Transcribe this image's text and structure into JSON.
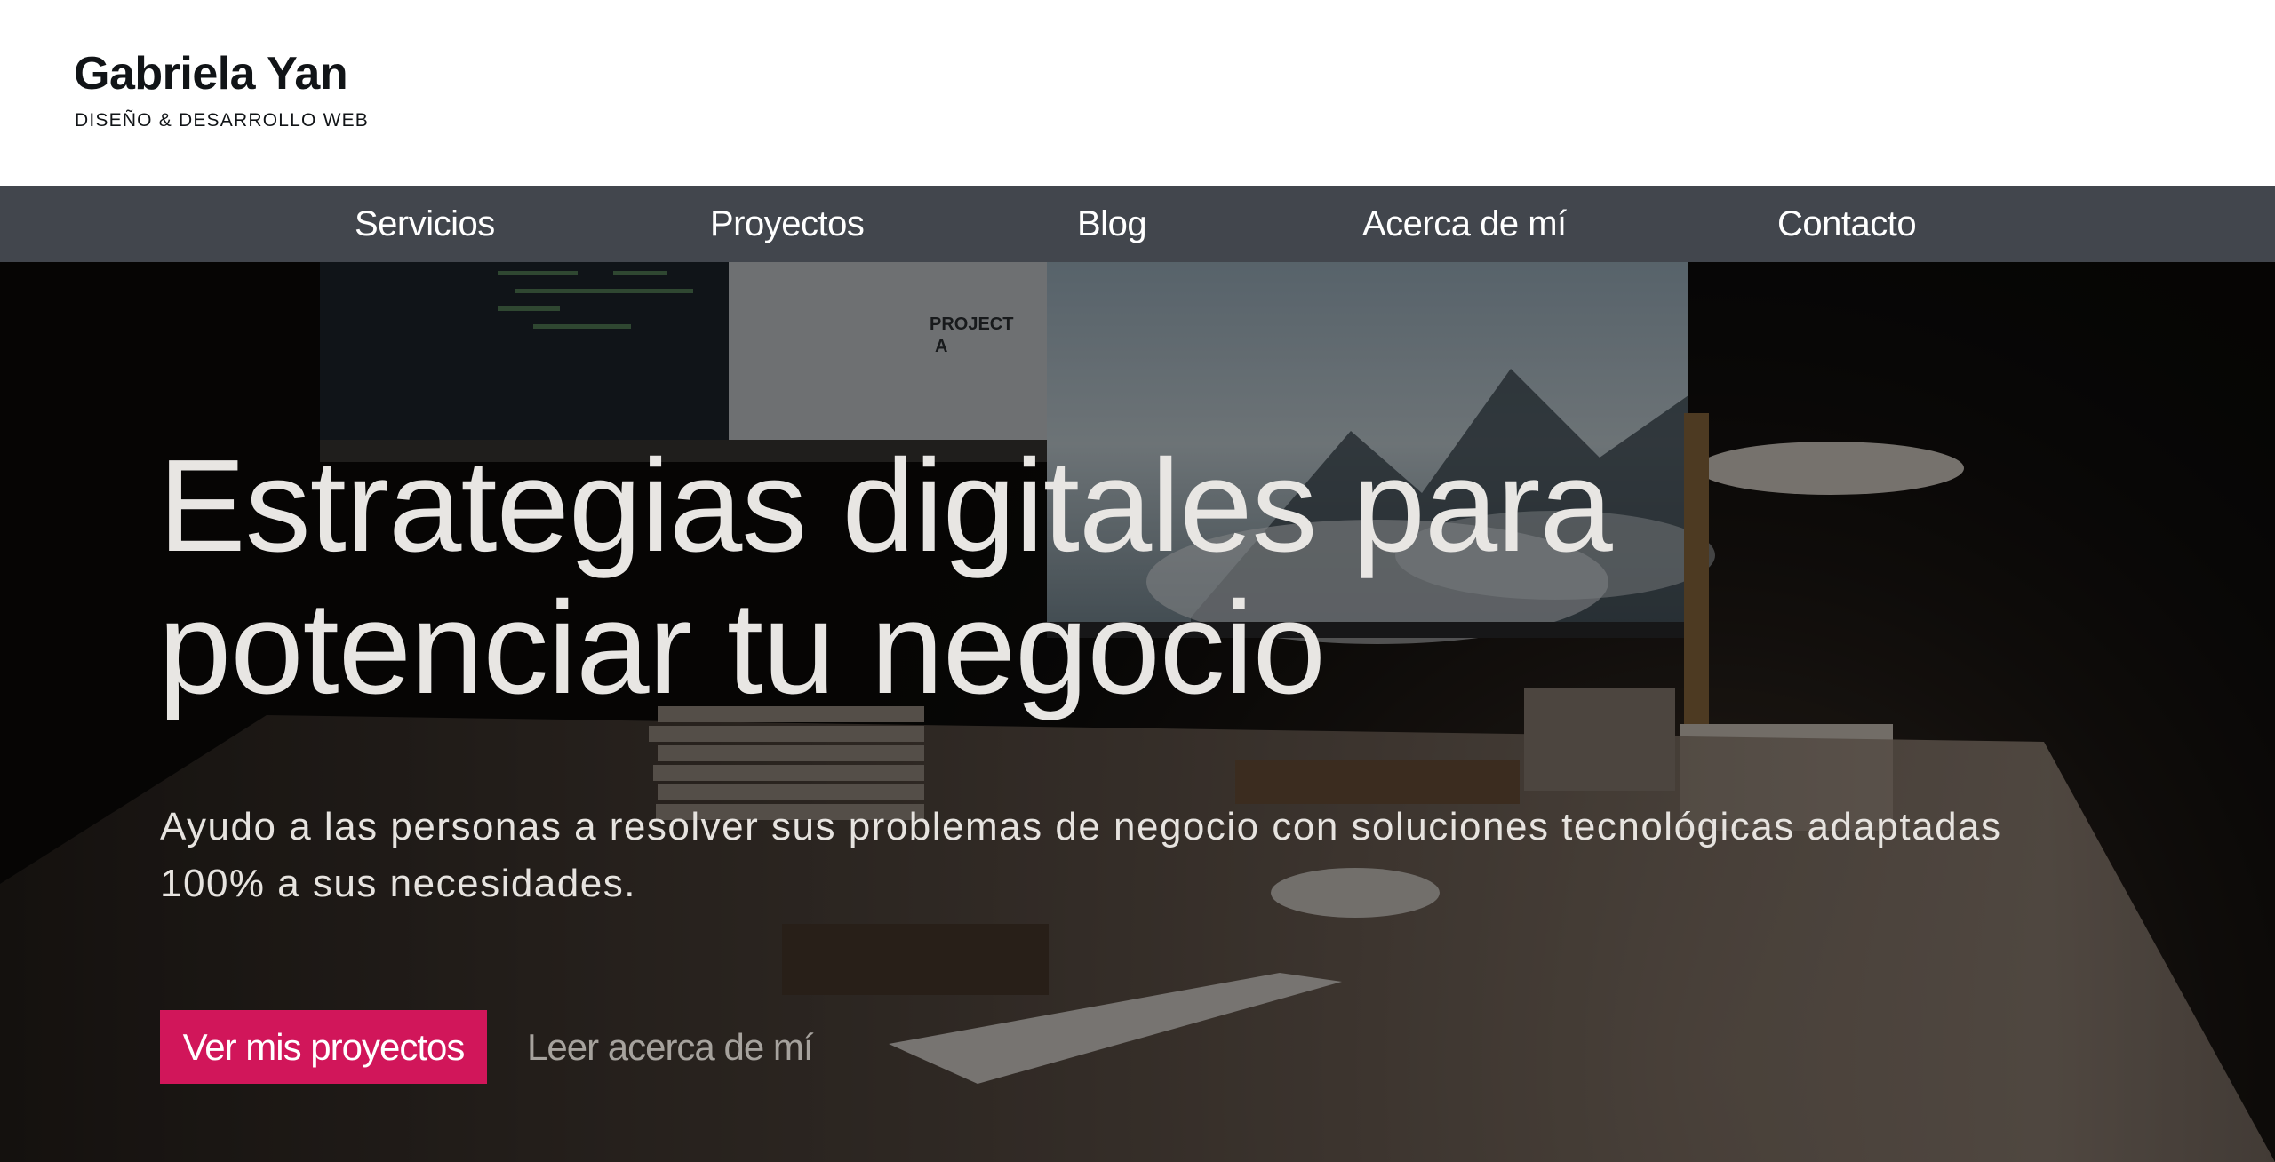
{
  "header": {
    "site_title": "Gabriela Yan",
    "tagline": "DISEÑO & DESARROLLO WEB"
  },
  "nav": {
    "items": [
      {
        "label": "Servicios"
      },
      {
        "label": "Proyectos"
      },
      {
        "label": "Blog"
      },
      {
        "label": "Acerca de mí"
      },
      {
        "label": "Contacto"
      }
    ]
  },
  "hero": {
    "title_line1": "Estrategias digitales para",
    "title_line2": "potenciar tu negocio",
    "subtitle_line1": "Ayudo a las personas a resolver sus problemas de negocio con soluciones tecnológicas adaptadas",
    "subtitle_line2": "100% a sus necesidades.",
    "primary_cta": "Ver mis proyectos",
    "secondary_cta": "Leer acerca de mí",
    "screen_text_line1": "PROJECT",
    "screen_text_line2": "A"
  },
  "colors": {
    "nav_bg": "#42464d",
    "cta_accent": "#d1165a",
    "header_bg": "#ffffff",
    "hero_overlay": "#0c0b0a"
  }
}
